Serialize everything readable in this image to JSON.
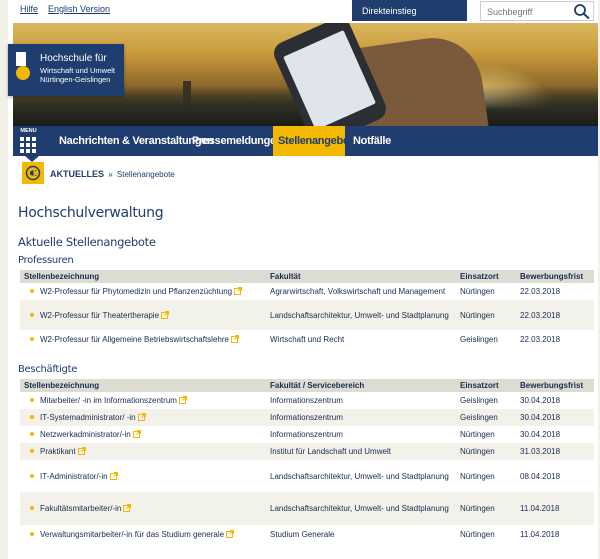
{
  "topbar": {
    "hilfe": "Hilfe",
    "english": "English Version",
    "direkteinstieg": "Direkteinstieg",
    "search_placeholder": "Suchbegriff"
  },
  "logo": {
    "line1": "Hochschule für",
    "line2": "Wirtschaft und Umwelt",
    "line3": "Nürtingen-Geislingen"
  },
  "nav": {
    "menu_label": "MENU",
    "items": [
      "Nachrichten & Veranstaltungen",
      "Pressemeldungen",
      "Stellenangebote",
      "Notfälle"
    ],
    "active_index": 2
  },
  "breadcrumb": {
    "home": "AKTUELLES",
    "separator": "»",
    "current": "Stellenangebote"
  },
  "headings": {
    "page_title": "Hochschulverwaltung",
    "section": "Aktuelle Stellenangebote",
    "professuren": "Professuren",
    "beschaeftigte": "Beschäftigte"
  },
  "professuren": {
    "columns": [
      "Stellenbezeichnung",
      "Fakultät",
      "Einsatzort",
      "Bewerbungsfrist"
    ],
    "rows": [
      {
        "title": "W2-Professur für Phytomedizin und Pflanzenzüchtung",
        "unit": "Agrarwirtschaft, Volkswirtschaft und Management",
        "ort": "Nürtingen",
        "frist": "22.03.2018"
      },
      {
        "title": "W2-Professur für Theatertherapie",
        "unit": "Landschaftsarchitektur, Umwelt- und Stadtplanung",
        "ort": "Nürtingen",
        "frist": "22.03.2018"
      },
      {
        "title": "W2-Professur für Allgemeine Betriebswirtschaftslehre",
        "unit": "Wirtschaft und Recht",
        "ort": "Geislingen",
        "frist": "22.03.2018"
      }
    ]
  },
  "beschaeftigte": {
    "columns": [
      "Stellenbezeichnung",
      "Fakultät / Servicebereich",
      "Einsatzort",
      "Bewerbungsfrist"
    ],
    "rows": [
      {
        "title": "Mitarbeiter/ -in im Informationszentrum",
        "unit": "Informationszentrum",
        "ort": "Geislingen",
        "frist": "30.04.2018"
      },
      {
        "title": "IT-Systemadministrator/ -in",
        "unit": "Informationszentrum",
        "ort": "Geislingen",
        "frist": "30.04.2018"
      },
      {
        "title": "Netzwerkadministrator/-in",
        "unit": "Informationszentrum",
        "ort": "Nürtingen",
        "frist": "30.04.2018"
      },
      {
        "title": "Praktikant",
        "unit": "Institut für Landschaft und Umwelt",
        "ort": "Nürtingen",
        "frist": "31.03.2018"
      },
      {
        "title": "IT-Administrator/-in",
        "unit": "Landschaftsarchitektur, Umwelt- und Stadtplanung",
        "ort": "Nürtingen",
        "frist": "08.04.2018"
      },
      {
        "title": "Fakultätsmitarbeiter/-in",
        "unit": "Landschaftsarchitektur, Umwelt- und Stadtplanung",
        "ort": "Nürtingen",
        "frist": "11.04.2018"
      },
      {
        "title": "Verwaltungsmitarbeiter/-in für das Studium generale",
        "unit": "Studium Generale",
        "ort": "Nürtingen",
        "frist": "11.04.2018"
      }
    ]
  },
  "colors": {
    "brand_blue": "#1f3d6e",
    "accent_yellow": "#f2b900",
    "table_header": "#dcdcd3",
    "page_bg": "#f1f1e8"
  },
  "icons": {
    "search": "search-icon",
    "menu": "menu-grid-icon",
    "breadcrumb": "megaphone-icon",
    "external": "external-link-icon",
    "bullet": "bullet-icon"
  }
}
